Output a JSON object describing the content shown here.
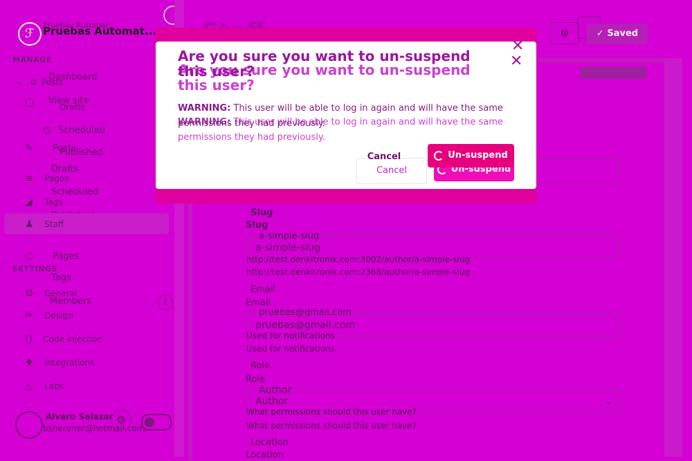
{
  "sidebar": {
    "site_name": "Pruebas Automat...",
    "site_name_echo": "Pruebas Automat...",
    "sections": {
      "manage": "MANAGE",
      "settings": "SETTINGS"
    },
    "items": [
      {
        "label": "Dashboard",
        "icon": "house-icon"
      },
      {
        "label": "Posts",
        "icon": "pencil-icon"
      },
      {
        "label": "View site",
        "icon": "window-icon"
      },
      {
        "label": "Drafts",
        "icon": "none"
      },
      {
        "label": "Scheduled",
        "icon": "clock-icon"
      },
      {
        "label": "Posts",
        "icon": "edit-icon"
      },
      {
        "label": "Published",
        "icon": "none"
      },
      {
        "label": "Drafts",
        "icon": "none"
      },
      {
        "label": "Pages",
        "icon": "page-icon"
      },
      {
        "label": "Scheduled",
        "icon": "none"
      },
      {
        "label": "Tags",
        "icon": "tag-icon"
      },
      {
        "label": "Published",
        "icon": "none"
      },
      {
        "label": "Staff",
        "icon": "people-icon"
      },
      {
        "label": "Pages",
        "icon": "none"
      },
      {
        "label": "Tags",
        "icon": "none"
      },
      {
        "label": "General",
        "icon": "gear-icon"
      },
      {
        "label": "Members",
        "icon": "people-icon"
      },
      {
        "label": "Design",
        "icon": "brush-icon"
      },
      {
        "label": "Code injection",
        "icon": "code-icon"
      },
      {
        "label": "Integrations",
        "icon": "puzzle-icon"
      },
      {
        "label": "Labs",
        "icon": "flask-icon"
      }
    ],
    "members_count": "1",
    "user": {
      "name": "Alvaro Salazar",
      "email": "bsheroner@hotmail.com"
    }
  },
  "main": {
    "title": "Staff",
    "saved_label": "Saved",
    "slug_label": "Slug",
    "slug_label_echo": "Slug",
    "slug_value": "a-simple-slug",
    "slug_value_echo": "a-simple-slug",
    "slug_url": "http://test.denkitronik.com:3002/author/a-simple-slug",
    "slug_url_echo": "http://test.denkitronik.com:2368/author/a-simple-slug",
    "email_label": "Email",
    "email_label_echo": "Email",
    "email_value": "pruebas@gmail.com",
    "email_value_echo": "pruebas@gmail.com",
    "email_hint": "Used for notifications",
    "email_hint_echo": "Used for notifications",
    "role_label": "Role",
    "role_label_echo": "Role",
    "role_value": "Author",
    "role_value_echo": "Author",
    "role_hint": "What permissions should this user have?",
    "role_hint_echo": "What permissions should this user have?",
    "location_label": "Location",
    "location_label_echo": "Location"
  },
  "modal": {
    "title": "Are you sure you want to un-suspend this user?",
    "title_echo": "Are you sure you want to un-suspend this user?",
    "warning_label": "WARNING:",
    "warning_text": " This user will be able to log in again and will have the same permissions they had previously.",
    "warning_label_echo": "WARNING:",
    "warning_text_echo": " This user will be able to log in again and will have the same permissions they had previously.",
    "cancel_label": "Cancel",
    "cancel_label_echo": "Cancel",
    "confirm_label": "Un-suspend",
    "confirm_label_echo": "Un-suspend"
  },
  "colors": {
    "background": "#d400d4",
    "modal_accent": "#e6007e",
    "modal_title": "#9b16a0"
  }
}
